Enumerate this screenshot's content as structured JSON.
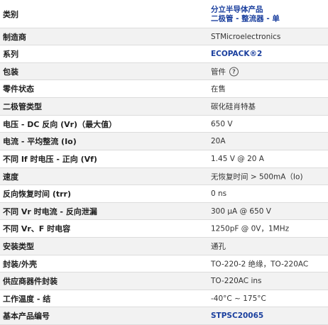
{
  "rows": [
    {
      "label": "类别",
      "value": "分立半导体产品",
      "value2": "二极管 - 整流器 - 单"
    },
    {
      "label": "制造商",
      "value": "STMicroelectronics"
    },
    {
      "label": "系列",
      "value": "ECOPACK®2"
    },
    {
      "label": "包装",
      "value": "管件",
      "icon": "help-circle-icon"
    },
    {
      "label": "零件状态",
      "value": "在售"
    },
    {
      "label": "二极管类型",
      "value": "碳化硅肖特基"
    },
    {
      "label": "电压 - DC 反向 (Vr)（最大值）",
      "value": "650 V"
    },
    {
      "label": "电流 - 平均整流 (Io)",
      "value": "20A"
    },
    {
      "label": "不同 If 时电压 - 正向 (Vf)",
      "value": "1.45 V @ 20 A"
    },
    {
      "label": "速度",
      "value": "无恢复时间 > 500mA（Io)"
    },
    {
      "label": "反向恢复时间 (trr)",
      "value": "0 ns"
    },
    {
      "label": "不同 Vr 时电流 - 反向泄漏",
      "value": "300 µA @ 650 V"
    },
    {
      "label": "不同 Vr、F 时电容",
      "value": "1250pF @ 0V，1MHz"
    },
    {
      "label": "安装类型",
      "value": "通孔"
    },
    {
      "label": "封装/外壳",
      "value": "TO-220-2 绝缘，TO-220AC"
    },
    {
      "label": "供应商器件封装",
      "value": "TO-220AC ins"
    },
    {
      "label": "工作温度 - 结",
      "value": "-40°C ~ 175°C"
    },
    {
      "label": "基本产品编号",
      "value": "STPSC20065"
    }
  ],
  "colors": {
    "link": "#1a3f9e",
    "alt_row": "#f2f2f2",
    "border": "#dcdcdc"
  }
}
